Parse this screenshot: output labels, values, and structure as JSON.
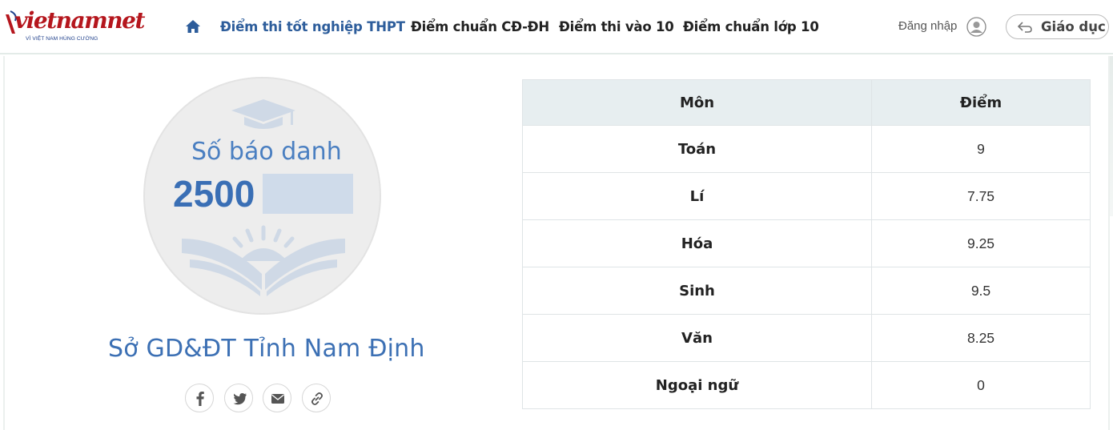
{
  "header": {
    "logo_text_main": "vietnam",
    "logo_text_net": "net",
    "logo_tagline": "VÌ VIỆT NAM HÙNG CƯỜNG",
    "nav": [
      {
        "label": "Điểm thi tốt nghiệp THPT",
        "active": true
      },
      {
        "label": "Điểm chuẩn CĐ-ĐH",
        "active": false
      },
      {
        "label": "Điểm thi vào 10",
        "active": false
      },
      {
        "label": "Điểm chuẩn lớp 10",
        "active": false
      }
    ],
    "login_label": "Đăng nhập",
    "section_button_label": "Giáo dục"
  },
  "candidate": {
    "sbd_label": "Số báo danh",
    "sbd_prefix": "2500",
    "department": "Sở GD&ĐT Tỉnh Nam Định"
  },
  "share": [
    {
      "icon": "facebook-icon"
    },
    {
      "icon": "twitter-icon"
    },
    {
      "icon": "email-icon"
    },
    {
      "icon": "link-icon"
    }
  ],
  "scores_table": {
    "headers": [
      "Môn",
      "Điểm"
    ],
    "rows": [
      {
        "subject": "Toán",
        "score": "9"
      },
      {
        "subject": "Lí",
        "score": "7.75"
      },
      {
        "subject": "Hóa",
        "score": "9.25"
      },
      {
        "subject": "Sinh",
        "score": "9.5"
      },
      {
        "subject": "Văn",
        "score": "8.25"
      },
      {
        "subject": "Ngoại ngữ",
        "score": "0"
      }
    ]
  },
  "colors": {
    "brand_red": "#b5161d",
    "accent_blue": "#3c70b4",
    "table_header_bg": "#e7eef0"
  }
}
